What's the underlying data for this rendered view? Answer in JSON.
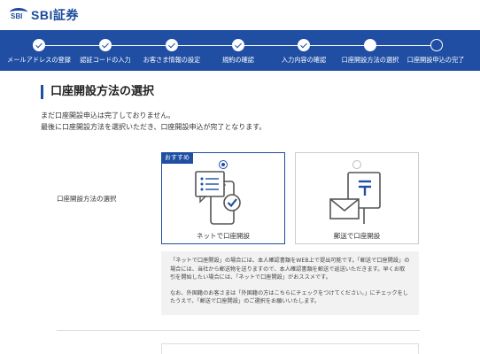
{
  "header": {
    "logo_small": "SBI",
    "logo_text": "SBI証券"
  },
  "progress": {
    "steps": [
      {
        "label": "メールアドレスの登録",
        "state": "done"
      },
      {
        "label": "認証コードの入力",
        "state": "done"
      },
      {
        "label": "お客さま情報の設定",
        "state": "done"
      },
      {
        "label": "規約の確認",
        "state": "done"
      },
      {
        "label": "入力内容の確認",
        "state": "done"
      },
      {
        "label": "口座開設方法の選択",
        "state": "current"
      },
      {
        "label": "口座開設申込の完了",
        "state": "todo"
      }
    ]
  },
  "main": {
    "title": "口座開設方法の選択",
    "intro_line1": "まだ口座開設申込は完了しておりません。",
    "intro_line2": "最後に口座開設方法を選択いただき、口座開設申込が完了となります。",
    "row_label": "口座開設方法の選択",
    "options": [
      {
        "label": "ネットで口座開設",
        "badge": "おすすめ",
        "selected": true,
        "icon": "smartphone-checklist-icon"
      },
      {
        "label": "郵送で口座開設",
        "badge": "",
        "selected": false,
        "icon": "mailbox-envelope-icon"
      }
    ],
    "note_para1": "「ネットで口座開設」の場合には、本人確認書類をWEB上で提出可能です。「郵送で口座開設」の場合には、当社から郵送物を送りますので、本人確認書類を郵送で返送いただきます。早くお取引を開始したい場合には、「ネットで口座開設」がおススメです。",
    "note_para2": "なお、外国籍のお客さまは「外国籍の方はこちらにチェックをつけてください。」にチェックをしたうえで、「郵送で口座開設」のご選択をお願いいたします。"
  },
  "colors": {
    "brand": "#1f4ea3",
    "note_bg": "#f2f2f2"
  }
}
